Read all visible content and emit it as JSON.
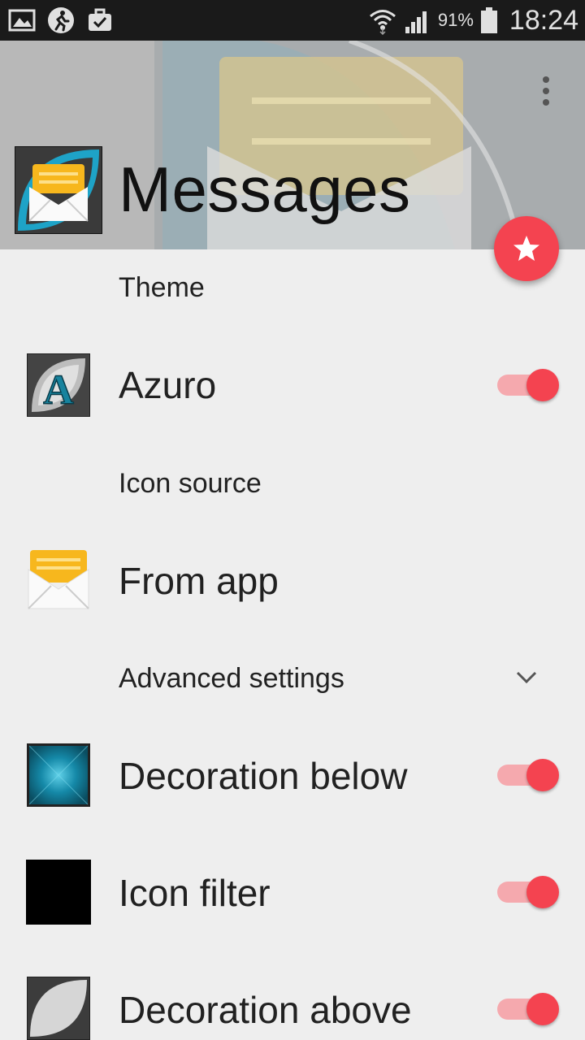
{
  "status_bar": {
    "battery": "91%",
    "time": "18:24"
  },
  "header": {
    "title": "Messages"
  },
  "sections": {
    "theme": "Theme",
    "icon_source": "Icon source",
    "advanced": "Advanced settings"
  },
  "rows": {
    "theme_row": {
      "label": "Azuro",
      "enabled": true
    },
    "source_row": {
      "label": "From app"
    },
    "decoration_below": {
      "label": "Decoration below",
      "enabled": true
    },
    "icon_filter": {
      "label": "Icon filter",
      "enabled": true
    },
    "decoration_above": {
      "label": "Decoration above",
      "enabled": true
    }
  },
  "colors": {
    "accent": "#f44350",
    "accent_track": "#f5a9ae",
    "background": "#eeeeee",
    "status_bar": "#1a1a1a"
  },
  "icons": [
    "gallery-icon",
    "running-icon",
    "briefcase-check-icon",
    "wifi-icon",
    "signal-icon",
    "battery-icon",
    "more-vert-icon",
    "star-icon",
    "chevron-down-icon"
  ]
}
